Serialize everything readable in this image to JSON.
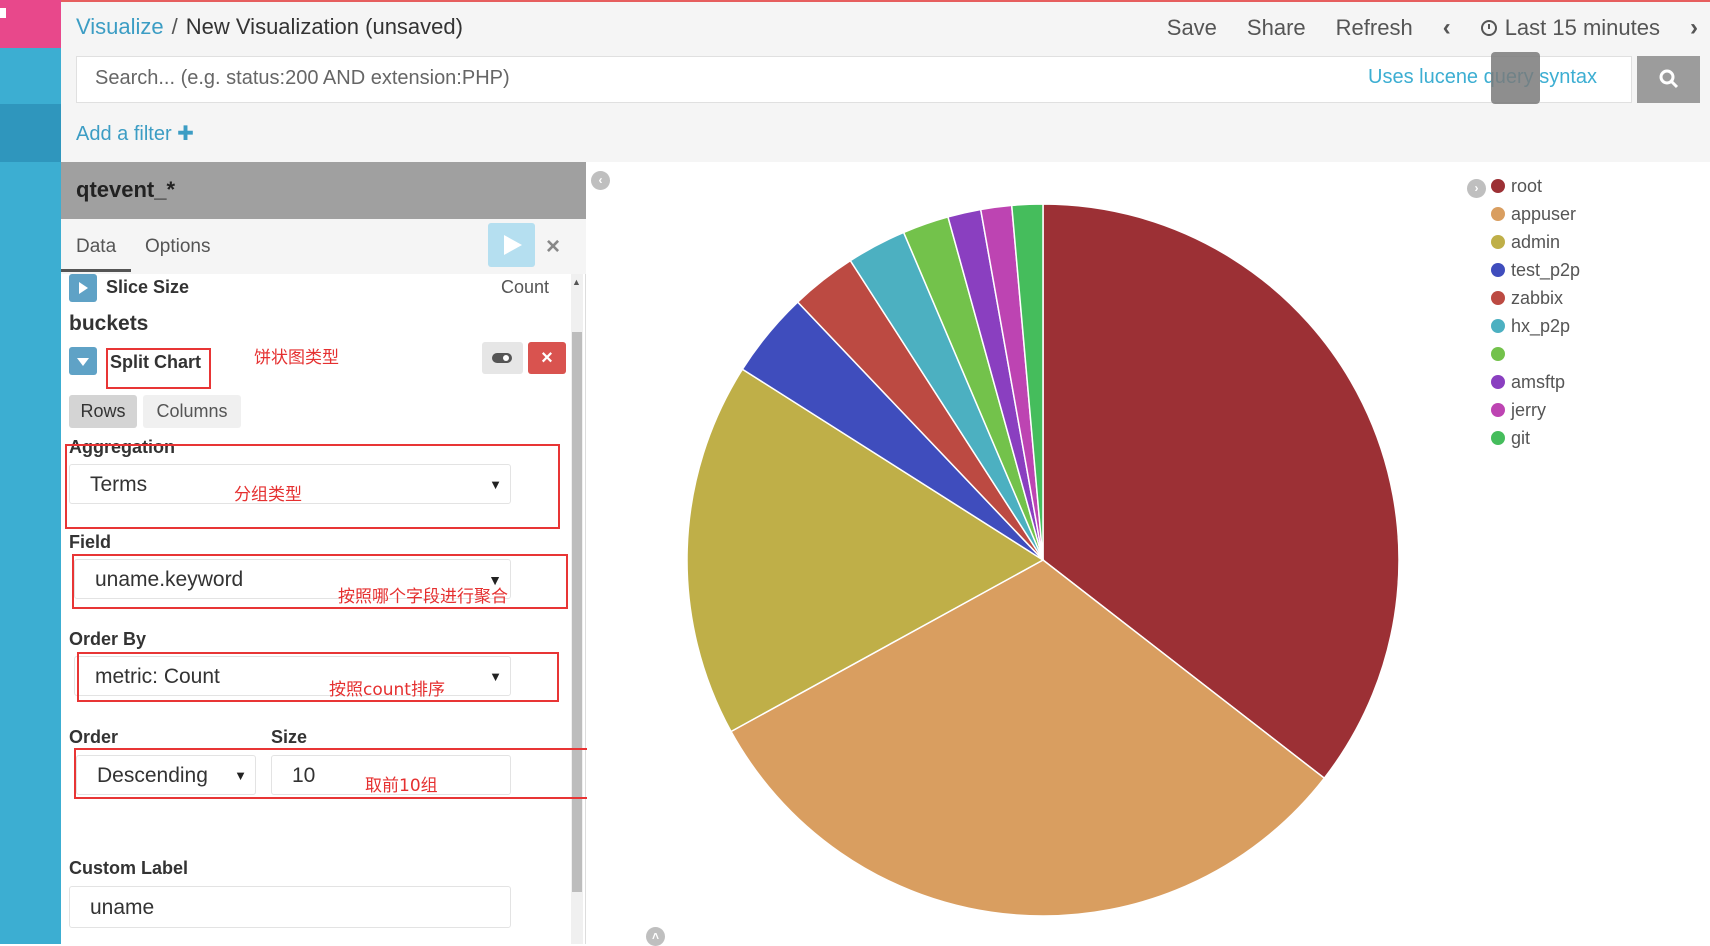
{
  "breadcrumb": {
    "root": "Visualize",
    "separator": "/",
    "current": "New Visualization (unsaved)"
  },
  "top_actions": {
    "save": "Save",
    "share": "Share",
    "refresh": "Refresh",
    "time_range": "Last 15 minutes"
  },
  "search": {
    "placeholder": "Search... (e.g. status:200 AND extension:PHP)",
    "syntax_link": "Uses lucene query syntax"
  },
  "filter": {
    "add_label": "Add a filter",
    "plus": "✚"
  },
  "sidebar": {
    "index_pattern": "qtevent_*",
    "tabs": [
      "Data",
      "Options"
    ],
    "metric": {
      "label": "Slice Size",
      "value": "Count"
    },
    "buckets_title": "buckets",
    "bucket": {
      "type_label": "Split Chart",
      "modes": [
        "Rows",
        "Columns"
      ]
    },
    "aggregation": {
      "label": "Aggregation",
      "value": "Terms"
    },
    "field": {
      "label": "Field",
      "value": "uname.keyword"
    },
    "order_by": {
      "label": "Order By",
      "value": "metric: Count"
    },
    "order": {
      "label": "Order",
      "value": "Descending"
    },
    "size": {
      "label": "Size",
      "value": "10"
    },
    "custom_label": {
      "label": "Custom Label",
      "value": "uname"
    }
  },
  "annotations": {
    "pie_type": "饼状图类型",
    "group_type": "分组类型",
    "field_note": "按照哪个字段进行聚合",
    "order_note": "按照count排序",
    "size_note": "取前10组"
  },
  "chart_data": {
    "type": "pie",
    "categories": [
      "root",
      "appuser",
      "admin",
      "test_p2p",
      "zabbix",
      "hx_p2p",
      "",
      "amsftp",
      "jerry",
      "git"
    ],
    "values": [
      35.5,
      31.5,
      17.0,
      3.9,
      3.0,
      2.7,
      2.1,
      1.5,
      1.4,
      1.4
    ],
    "colors": [
      "#9c3035",
      "#d99e60",
      "#bfaf48",
      "#3f4dbd",
      "#bc4a42",
      "#4cb0c1",
      "#73c24b",
      "#8a3fc0",
      "#bd44b2",
      "#45bd5c"
    ],
    "legend_position": "right"
  }
}
